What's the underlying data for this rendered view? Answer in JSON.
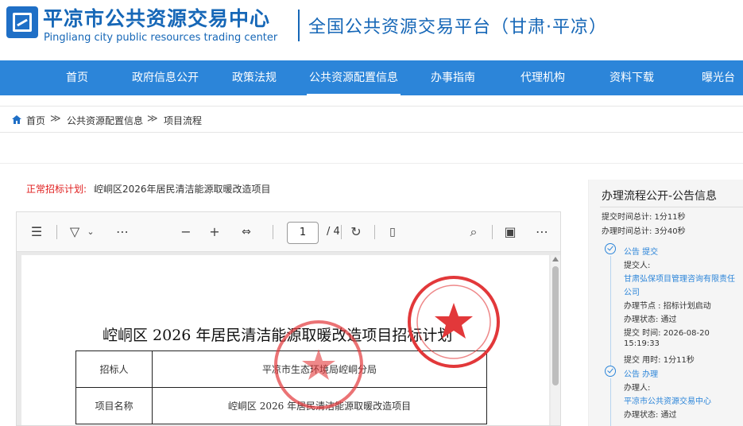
{
  "header": {
    "logo_cn": "平凉市公共资源交易中心",
    "logo_en": "Pingliang city public resources trading center",
    "platform_title": "全国公共资源交易平台（甘肃·平凉）"
  },
  "nav": {
    "items": [
      "首页",
      "政府信息公开",
      "政策法规",
      "公共资源配置信息",
      "办事指南",
      "代理机构",
      "资料下载",
      "曝光台"
    ],
    "active_index": 3
  },
  "breadcrumb": {
    "home": "首页",
    "sep": "≫",
    "level1": "公共资源配置信息",
    "level2": "项目流程"
  },
  "plan": {
    "label": "正常招标计划:",
    "value": "崆峒区2026年居民清洁能源取暖改造项目"
  },
  "pdf": {
    "current_page": "1",
    "total_pages": "/ 4",
    "doc_title": "崆峒区 2026 年居民清洁能源取暖改造项目招标计划",
    "rows": [
      {
        "key": "招标人",
        "value": "平凉市生态环境局崆峒分局"
      },
      {
        "key": "项目名称",
        "value": "崆峒区 2026 年居民清洁能源取暖改造项目"
      }
    ]
  },
  "sidebar": {
    "title": "办理流程公开-公告信息",
    "submit_total": "提交时间总计:  1分11秒",
    "handle_total": "办理时间总计:  3分40秒",
    "step1": {
      "label": "公告 提交",
      "submitter_label": "提交人:",
      "submitter_line1": "甘肃弘保项目管理咨询有限责任",
      "submitter_line2": "公司",
      "node": "办理节点 :  招标计划启动",
      "status": "办理状态:  通过",
      "submit_time": "提交 时间:  2026-08-20",
      "submit_time2": "15:19:33",
      "used_time": "提交 用时:  1分11秒"
    },
    "step2": {
      "label": "公告 办理",
      "handler_label": "办理人:",
      "handler": "平凉市公共资源交易中心",
      "status": "办理状态:  通过"
    }
  },
  "colors": {
    "brand_blue": "#1667b7",
    "nav_blue": "#2c85d9",
    "plan_red": "#e02020"
  }
}
